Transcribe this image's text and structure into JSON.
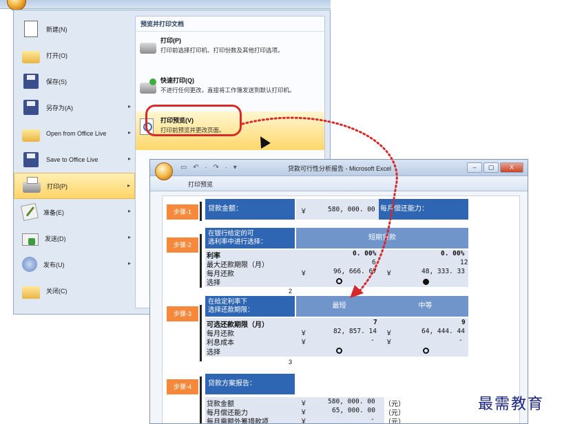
{
  "office_menu": {
    "items": [
      {
        "label": "新建(N)",
        "icon": "new-document-icon",
        "has_submenu": false
      },
      {
        "label": "打开(O)",
        "icon": "open-folder-icon",
        "has_submenu": false
      },
      {
        "label": "保存(S)",
        "icon": "save-icon",
        "has_submenu": false
      },
      {
        "label": "另存为(A)",
        "icon": "save-as-icon",
        "has_submenu": true
      },
      {
        "label": "Open from Office Live",
        "icon": "office-live-folder-icon",
        "has_submenu": true
      },
      {
        "label": "Save to Office Live",
        "icon": "office-live-save-icon",
        "has_submenu": true
      },
      {
        "label": "打印(P)",
        "icon": "printer-icon",
        "has_submenu": true,
        "active": true
      },
      {
        "label": "准备(E)",
        "icon": "prepare-icon",
        "has_submenu": true
      },
      {
        "label": "发送(D)",
        "icon": "send-icon",
        "has_submenu": true
      },
      {
        "label": "发布(U)",
        "icon": "publish-icon",
        "has_submenu": true
      },
      {
        "label": "关闭(C)",
        "icon": "close-folder-icon",
        "has_submenu": false
      }
    ],
    "submenu": {
      "title": "预览并打印文档",
      "options": [
        {
          "title": "打印(P)",
          "desc": "打印前选择打印机、打印份数及其他打印选项。"
        },
        {
          "title": "快速打印(Q)",
          "desc": "不进行任何更改，直接将工作簿发送到默认打印机。"
        },
        {
          "title": "打印预览(V)",
          "desc": "打印前预览并更改页面。"
        }
      ]
    }
  },
  "excel": {
    "qat": "▭ ↶ · ↷ · ▾",
    "title": "贷款可行性分析报告 - Microsoft Excel",
    "window_controls": [
      "–",
      "▢",
      "X"
    ],
    "ribbon_tab": "打印预览",
    "sheet": {
      "step1": {
        "label": "步骤-1",
        "title": "贷款金额：",
        "currency": "￥",
        "amount": "580, 000. 00",
        "right": "每月偿还能力："
      },
      "step2": {
        "label": "步骤-2",
        "title": "在银行给定的可\n选利率中进行选择：",
        "header": "短期贷款",
        "rows": [
          {
            "label": "利率",
            "a": "0. 00%",
            "b": "0. 00%"
          },
          {
            "label": "最大还款期限（月）",
            "a": "6",
            "b": "12"
          },
          {
            "label": "每月还款",
            "cur": "￥",
            "a": "96, 666. 67",
            "cur2": "￥",
            "b": "48, 333. 33"
          },
          {
            "label": "选择"
          }
        ],
        "page_num": "2"
      },
      "step3": {
        "label": "步骤-3",
        "title": "在给定利率下\n选择还款期限：",
        "col1": "最短",
        "col2": "中等",
        "rows": [
          {
            "label": "可选还款期限（月）",
            "a": "7",
            "b": "9"
          },
          {
            "label": "每月还款",
            "cur": "￥",
            "a": "82, 857. 14",
            "cur2": "￥",
            "b": "64, 444. 44"
          },
          {
            "label": "利息成本",
            "cur": "￥",
            "a": "-",
            "cur2": "￥",
            "b": "-"
          },
          {
            "label": "选择"
          }
        ],
        "page_num": "3"
      },
      "step4": {
        "label": "步骤-4",
        "title": "贷款方案报告：",
        "rows": [
          {
            "label": "贷款金额",
            "cur": "￥",
            "a": "580, 000. 00",
            "unit": "（元）"
          },
          {
            "label": "每月偿还能力",
            "cur": "￥",
            "a": "65, 000. 00",
            "unit": "（元）"
          },
          {
            "label": "每月需额外筹措款项",
            "cur": "￥",
            "a": "-",
            "unit": "（元）"
          }
        ]
      }
    }
  },
  "watermark": "最需教育",
  "colors": {
    "step_orange": "#f5883a",
    "block_blue": "#2f66b3",
    "highlight_red": "#d42a2a",
    "menu_bg": "#dfe8f3"
  }
}
